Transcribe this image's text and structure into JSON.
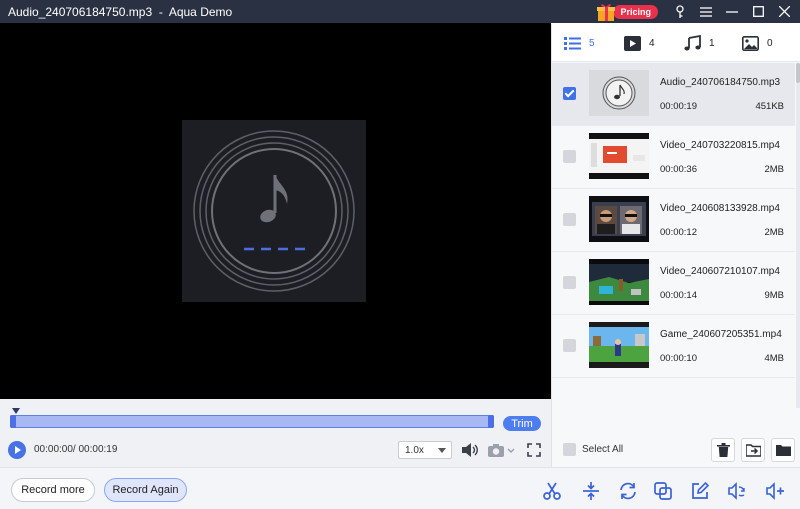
{
  "window": {
    "filename": "Audio_240706184750.mp3",
    "separator": "-",
    "app_name": "Aqua Demo",
    "pricing_label": "Pricing"
  },
  "tabs": [
    {
      "icon": "list-icon",
      "count": "5",
      "active": true
    },
    {
      "icon": "video-icon",
      "count": "4"
    },
    {
      "icon": "music-icon",
      "count": "1"
    },
    {
      "icon": "image-icon",
      "count": "0"
    }
  ],
  "files": [
    {
      "name": "Audio_240706184750.mp3",
      "duration": "00:00:19",
      "size": "451KB",
      "checked": true
    },
    {
      "name": "Video_240703220815.mp4",
      "duration": "00:00:36",
      "size": "2MB",
      "checked": false
    },
    {
      "name": "Video_240608133928.mp4",
      "duration": "00:00:12",
      "size": "2MB",
      "checked": false
    },
    {
      "name": "Video_240607210107.mp4",
      "duration": "00:00:14",
      "size": "9MB",
      "checked": false
    },
    {
      "name": "Game_240607205351.mp4",
      "duration": "00:00:10",
      "size": "4MB",
      "checked": false
    }
  ],
  "player": {
    "time": "00:00:00/ 00:00:19",
    "speed": "1.0x",
    "trim_label": "Trim"
  },
  "bottom": {
    "record_more": "Record more",
    "record_again": "Record Again",
    "select_all": "Select All"
  },
  "colors": {
    "accent": "#4a74e8",
    "titlebar": "#2a3142",
    "pricing": "#e8314c"
  }
}
